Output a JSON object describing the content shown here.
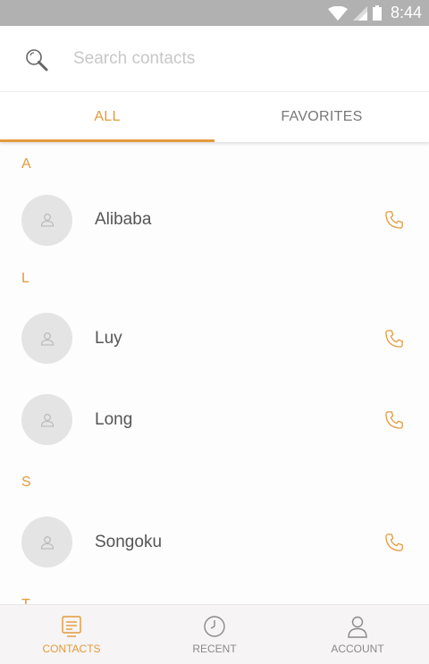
{
  "status_bar": {
    "time": "8:44",
    "icons": [
      "wifi-icon",
      "signal-icon",
      "battery-icon"
    ]
  },
  "search": {
    "placeholder": "Search contacts",
    "value": "",
    "icon": "search-icon"
  },
  "tabs": [
    {
      "label": "ALL",
      "active": true
    },
    {
      "label": "FAVORITES",
      "active": false
    }
  ],
  "contacts": {
    "sections": [
      {
        "letter": "A",
        "items": [
          {
            "name": "Alibaba"
          }
        ]
      },
      {
        "letter": "L",
        "items": [
          {
            "name": "Luy"
          },
          {
            "name": "Long"
          }
        ]
      },
      {
        "letter": "S",
        "items": [
          {
            "name": "Songoku"
          }
        ]
      },
      {
        "letter": "T",
        "items": []
      }
    ],
    "avatar_icon": "person-icon",
    "call_icon": "phone-icon"
  },
  "bottom_nav": [
    {
      "label": "CONTACTS",
      "icon": "contacts-icon",
      "active": true
    },
    {
      "label": "RECENT",
      "icon": "clock-icon",
      "active": false
    },
    {
      "label": "ACCOUNT",
      "icon": "account-icon",
      "active": false
    }
  ],
  "colors": {
    "accent": "#e39a3b",
    "status_bar": "#b1b1b1",
    "avatar_bg": "#e4e4e4"
  }
}
